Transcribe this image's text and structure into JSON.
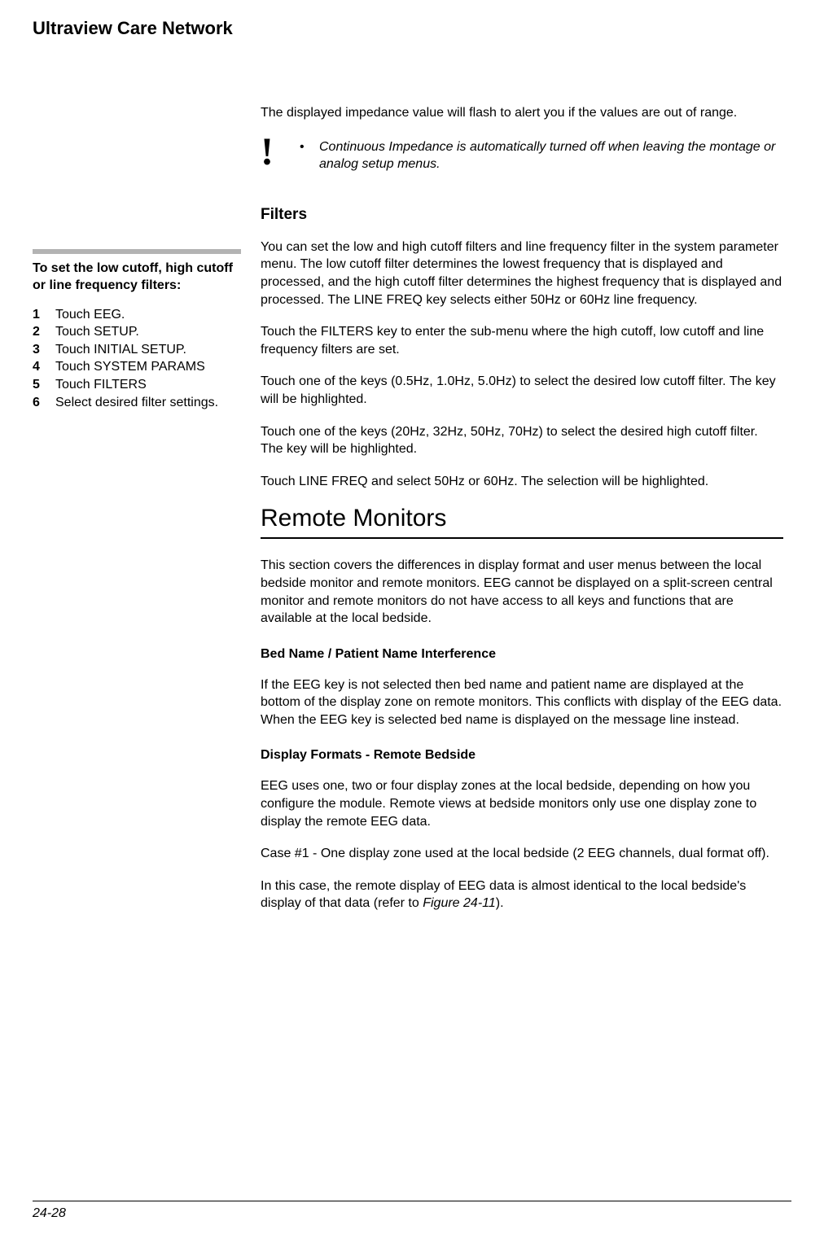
{
  "header": {
    "title": "Ultraview Care Network"
  },
  "intro": {
    "para": "The displayed impedance value will flash to alert you if the values are out of range."
  },
  "note": {
    "icon_label": "!",
    "items": [
      "Continuous Impedance is automatically turned off when leaving the montage or analog setup menus."
    ]
  },
  "sidebar": {
    "title": "To set the low cutoff, high cutoff or line frequency filters:",
    "steps": [
      "Touch EEG.",
      "Touch SETUP.",
      "Touch INITIAL SETUP.",
      "Touch SYSTEM PARAMS",
      "Touch FILTERS",
      "Select desired filter settings."
    ]
  },
  "filters": {
    "heading": "Filters",
    "p1": "You can set the low and high cutoff filters and line frequency filter in the system parameter menu. The low cutoff filter determines the lowest frequency that is displayed and processed, and the high cutoff filter determines the highest frequency that is displayed and processed. The LINE FREQ key selects either 50Hz or 60Hz line frequency.",
    "p2": "Touch the FILTERS key to enter the sub-menu where the high cutoff, low cutoff and line frequency filters are set.",
    "p3": "Touch one of the keys (0.5Hz, 1.0Hz, 5.0Hz) to select the desired low cutoff filter. The key will be highlighted.",
    "p4": "Touch one of the keys (20Hz, 32Hz, 50Hz, 70Hz) to select the desired high cutoff filter. The key will be highlighted.",
    "p5": "Touch LINE FREQ and select 50Hz or 60Hz. The selection will be highlighted."
  },
  "remote": {
    "heading": "Remote Monitors",
    "intro": "This section covers the differences in display format and user menus between the local bedside monitor and remote monitors. EEG cannot be displayed on a split-screen central monitor and remote monitors do not have access to all keys and functions that are available at the local bedside.",
    "sub1_heading": "Bed Name / Patient Name Interference",
    "sub1_body": "If the EEG key is not selected then bed name and patient name are displayed at the bottom of the display zone on remote monitors. This conflicts with display of the EEG data. When the EEG key is selected bed name is displayed on the message line instead.",
    "sub2_heading": "Display Formats - Remote Bedside",
    "sub2_p1": "EEG uses one, two or four display zones at the local bedside, depending on how you configure the module. Remote views at bedside monitors only use one display zone to display the remote EEG data.",
    "sub2_p2": "Case #1 - One display zone used at the local bedside (2 EEG channels, dual format off).",
    "sub2_p3_pre": "In this case, the remote display of EEG data is almost identical to the local bedside's display of that data (refer to ",
    "sub2_p3_ref": "Figure 24-11",
    "sub2_p3_post": ")."
  },
  "footer": {
    "page": "24-28"
  }
}
